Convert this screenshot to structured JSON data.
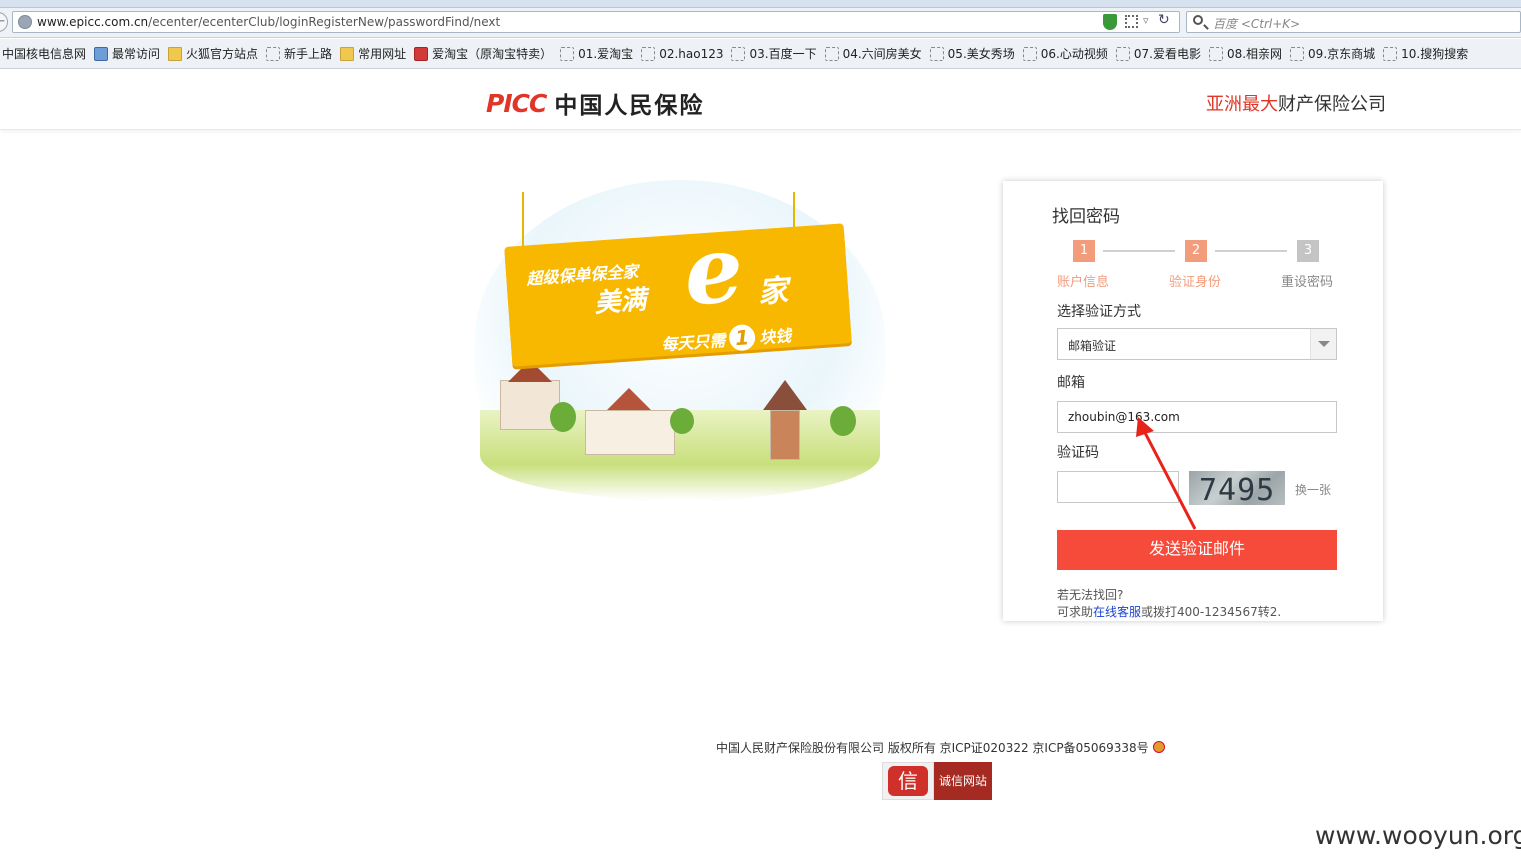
{
  "browser": {
    "back_glyph": "←",
    "url_host": "www.epicc.com.cn",
    "url_path": "/ecenter/ecenterClub/loginRegisterNew/passwordFind/next",
    "search_placeholder": "百度 <Ctrl+K>",
    "bookmarks": [
      {
        "label": "中国核电信息网",
        "icon": "none"
      },
      {
        "label": "最常访问",
        "icon": "blue"
      },
      {
        "label": "火狐官方站点",
        "icon": "folder"
      },
      {
        "label": "新手上路",
        "icon": "page"
      },
      {
        "label": "常用网址",
        "icon": "folder"
      },
      {
        "label": "爱淘宝（原淘宝特卖）",
        "icon": "red"
      },
      {
        "label": "01.爱淘宝",
        "icon": "page"
      },
      {
        "label": "02.hao123",
        "icon": "page"
      },
      {
        "label": "03.百度一下",
        "icon": "page"
      },
      {
        "label": "04.六间房美女",
        "icon": "page"
      },
      {
        "label": "05.美女秀场",
        "icon": "page"
      },
      {
        "label": "06.心动视频",
        "icon": "page"
      },
      {
        "label": "07.爱看电影",
        "icon": "page"
      },
      {
        "label": "08.相亲网",
        "icon": "page"
      },
      {
        "label": "09.京东商城",
        "icon": "page"
      },
      {
        "label": "10.搜狗搜索",
        "icon": "page"
      }
    ]
  },
  "header": {
    "logo_latin": "PICC",
    "logo_cn": "中国人民保险",
    "slogan_highlight": "亚洲最大",
    "slogan_rest": "财产保险公司"
  },
  "banner": {
    "line1": "超级保单保全家",
    "line2": "美满",
    "big_e": "e",
    "line2b": "家",
    "line3_a": "每天只需",
    "line3_num": "1",
    "line3_b": "块钱"
  },
  "form": {
    "title": "找回密码",
    "steps": [
      {
        "num": "1",
        "label": "账户信息",
        "state": "active"
      },
      {
        "num": "2",
        "label": "验证身份",
        "state": "active"
      },
      {
        "num": "3",
        "label": "重设密码",
        "state": "off"
      }
    ],
    "method_label": "选择验证方式",
    "method_value": "邮箱验证",
    "email_label": "邮箱",
    "email_value": "zhoubin@163.com",
    "captcha_label": "验证码",
    "captcha_value": "",
    "captcha_image_text": "7495",
    "refresh_label": "换一张",
    "submit_label": "发送验证邮件",
    "help_line1": "若无法找回?",
    "help_prefix": "可求助",
    "help_link": "在线客服",
    "help_suffix": "或拨打400-1234567转2."
  },
  "footer": {
    "copyright": "中国人民财产保险股份有限公司 版权所有 京ICP证020322 京ICP备05069338号",
    "trust_seal_glyph": "信",
    "trust_label": "诚信网站"
  },
  "watermark": "www.wooyun.org",
  "colors": {
    "brand_red": "#e13528",
    "step_active": "#f39c7c",
    "submit_bg": "#f64a3b",
    "link_blue": "#1a44d0",
    "annotation_arrow": "#e8231a"
  }
}
